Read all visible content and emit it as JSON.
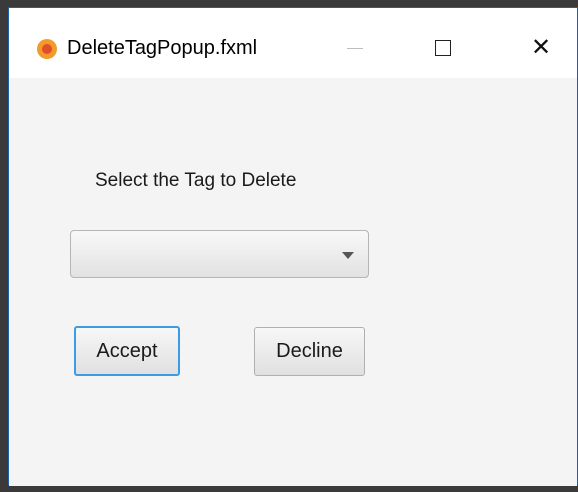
{
  "window": {
    "title": "DeleteTagPopup.fxml",
    "icon": "app-icon"
  },
  "controls": {
    "minimize_icon": "minimize-icon",
    "maximize_icon": "maximize-icon",
    "close_glyph": "✕"
  },
  "form": {
    "prompt": "Select the Tag to Delete",
    "tag_select": {
      "value": "",
      "options": []
    },
    "accept_label": "Accept",
    "decline_label": "Decline"
  },
  "colors": {
    "focus_border": "#3c9ce2",
    "window_border": "#1e5fa8"
  }
}
